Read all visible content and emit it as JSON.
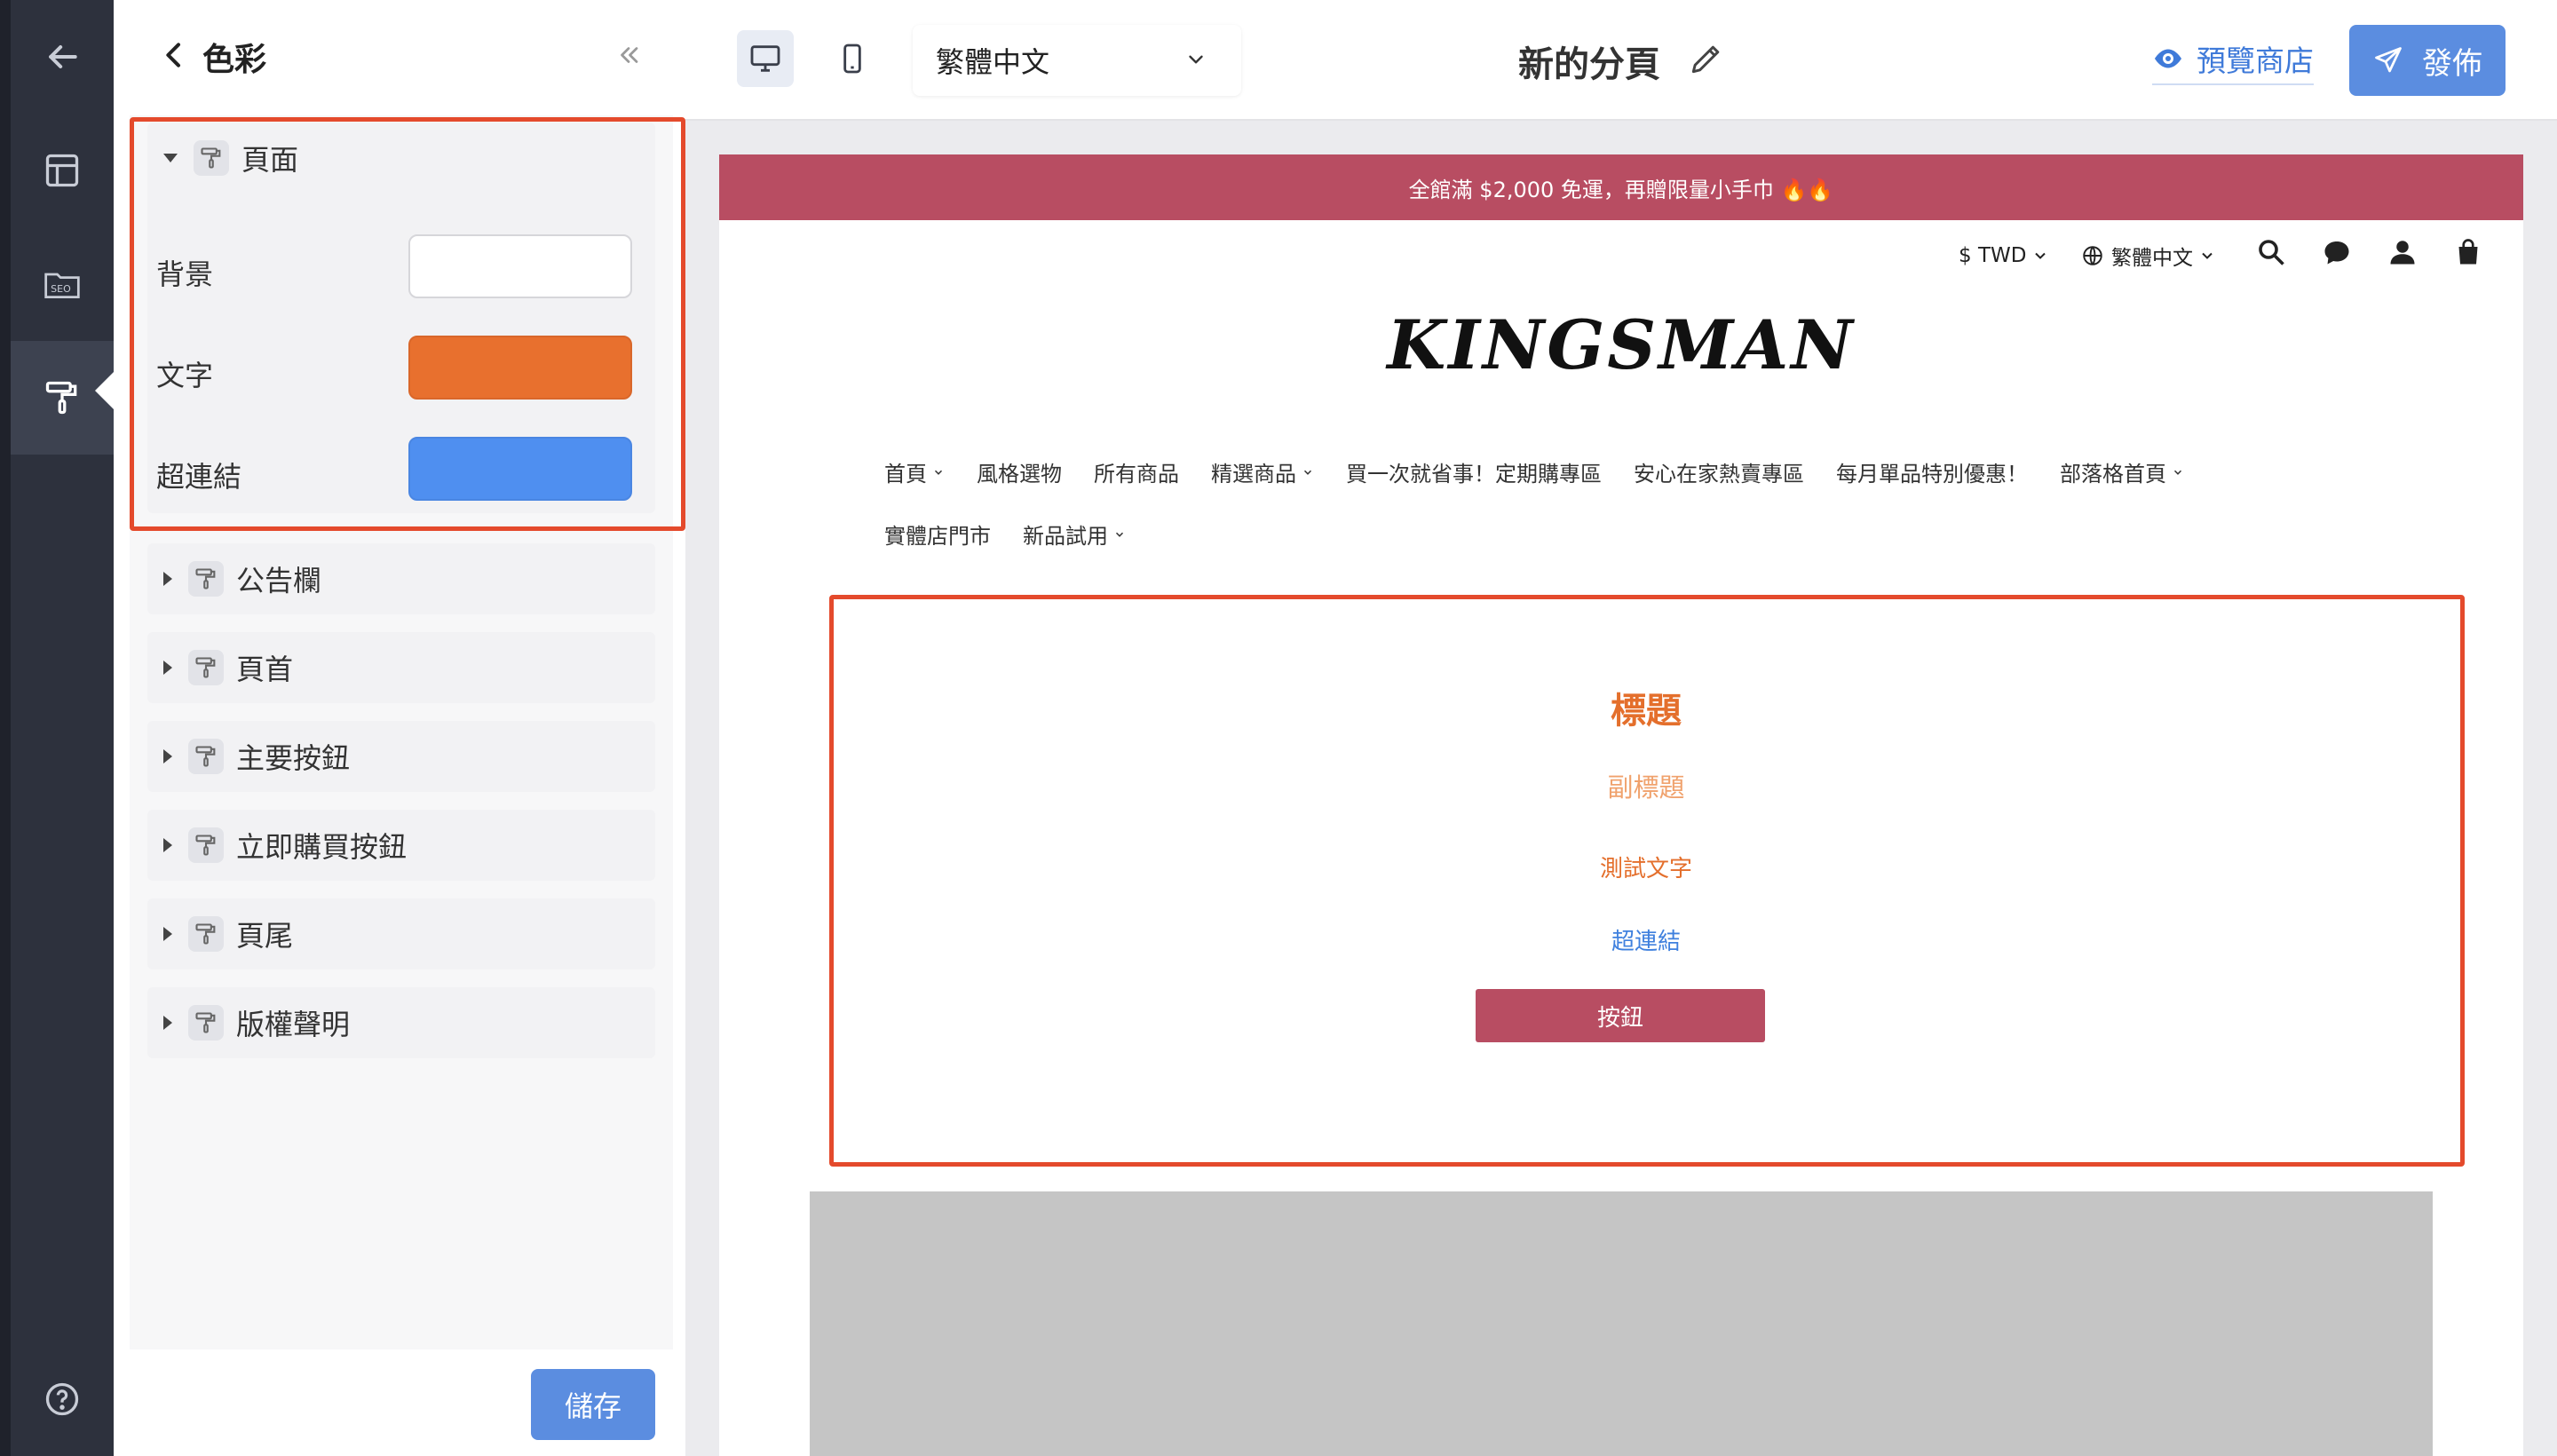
{
  "rail": {
    "items": [
      {
        "name": "back",
        "icon": "arrow-left-icon"
      },
      {
        "name": "layout",
        "icon": "layout-icon"
      },
      {
        "name": "seo",
        "icon": "seo-folder-icon",
        "label": "SEO"
      },
      {
        "name": "colors",
        "icon": "paint-roller-icon",
        "active": true
      },
      {
        "name": "help",
        "icon": "help-circle-icon"
      }
    ]
  },
  "panel": {
    "title": "色彩",
    "sections": [
      {
        "label": "頁面",
        "expanded": true
      },
      {
        "label": "公告欄"
      },
      {
        "label": "頁首"
      },
      {
        "label": "主要按鈕"
      },
      {
        "label": "立即購買按鈕"
      },
      {
        "label": "頁尾"
      },
      {
        "label": "版權聲明"
      }
    ],
    "page_colors": [
      {
        "label": "背景",
        "color": "#ffffff"
      },
      {
        "label": "文字",
        "color": "#e8702e"
      },
      {
        "label": "超連結",
        "color": "#4f8ff0"
      }
    ],
    "save_label": "儲存"
  },
  "topbar": {
    "language": "繁體中文",
    "page_name": "新的分頁",
    "preview_label": "預覽商店",
    "publish_label": "發佈"
  },
  "store": {
    "announcement": "全館滿 $2,000 免運，再贈限量小手巾 🔥🔥",
    "currency": "$ TWD",
    "language": "繁體中文",
    "logo": "KINGSMAN",
    "nav_row1": [
      {
        "label": "首頁",
        "dropdown": true
      },
      {
        "label": "風格選物"
      },
      {
        "label": "所有商品"
      },
      {
        "label": "精選商品",
        "dropdown": true
      },
      {
        "label": "買一次就省事！定期購專區"
      },
      {
        "label": "安心在家熱賣專區"
      },
      {
        "label": "每月單品特別優惠！"
      },
      {
        "label": "部落格首頁",
        "dropdown": true
      }
    ],
    "nav_row2": [
      {
        "label": "實體店門市"
      },
      {
        "label": "新品試用",
        "dropdown": true
      }
    ],
    "hero": {
      "title": "標題",
      "subtitle": "副標題",
      "text": "測試文字",
      "link": "超連結",
      "button": "按鈕"
    }
  },
  "colors": {
    "accent": "#5b8de0",
    "brand": "#b84d62",
    "highlight_box": "#e44a2c"
  }
}
